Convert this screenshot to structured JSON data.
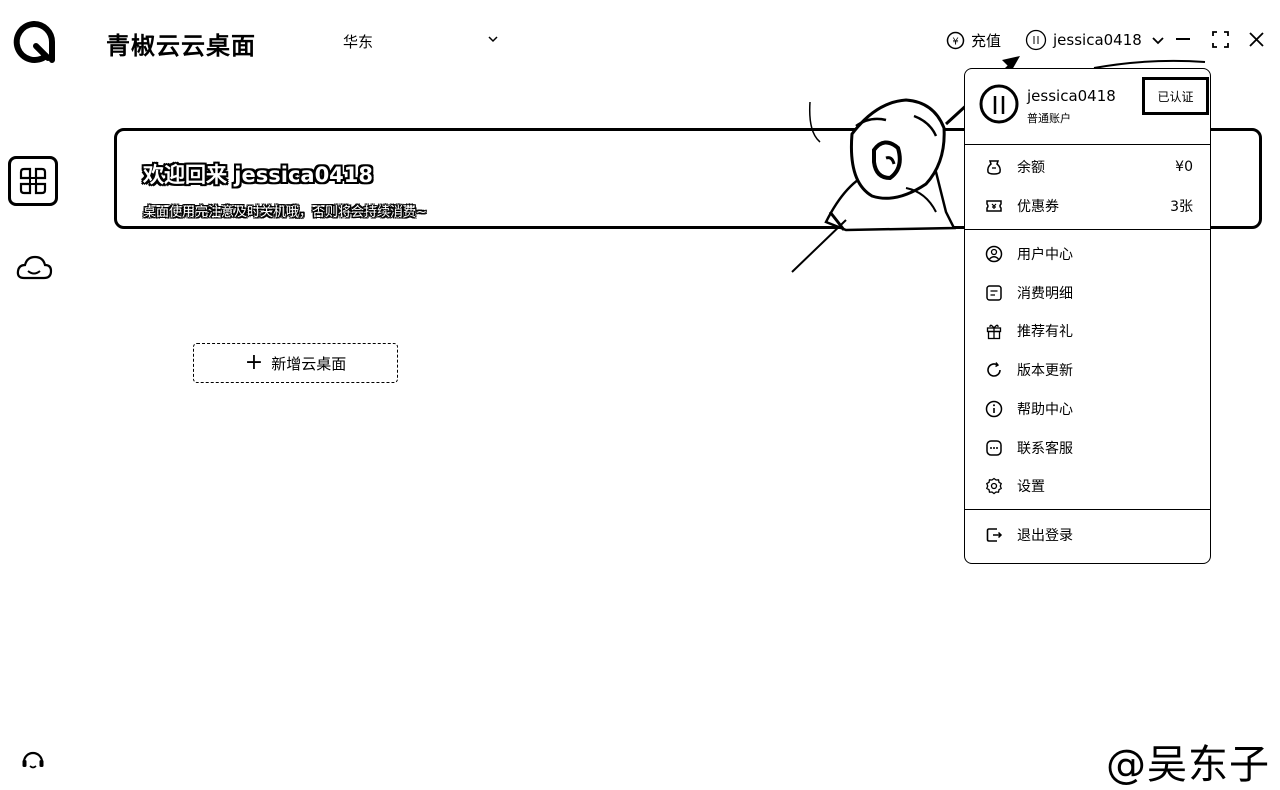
{
  "app": {
    "title": "青椒云云桌面",
    "region": "华东"
  },
  "topbar": {
    "recharge_label": "充值",
    "username": "jessica0418"
  },
  "banner": {
    "title": "欢迎回来 jessica0418",
    "subtitle": "桌面使用完注意及时关机哦，否则将会持续消费~"
  },
  "main": {
    "add_desktop_label": "新增云桌面"
  },
  "user_menu": {
    "username": "jessica0418",
    "account_type": "普通账户",
    "verified_label": "已认证",
    "balance": {
      "label": "余额",
      "value": "¥0",
      "icon": "wallet-icon"
    },
    "coupons": {
      "label": "优惠券",
      "value": "3张",
      "icon": "coupon-icon"
    },
    "items": [
      {
        "label": "用户中心",
        "icon": "user-icon"
      },
      {
        "label": "消费明细",
        "icon": "bill-icon"
      },
      {
        "label": "推荐有礼",
        "icon": "gift-icon"
      },
      {
        "label": "版本更新",
        "icon": "refresh-icon"
      },
      {
        "label": "帮助中心",
        "icon": "info-icon"
      },
      {
        "label": "联系客服",
        "icon": "chat-icon"
      },
      {
        "label": "设置",
        "icon": "gear-icon"
      }
    ],
    "logout_label": "退出登录"
  },
  "watermark": "@吴东子"
}
